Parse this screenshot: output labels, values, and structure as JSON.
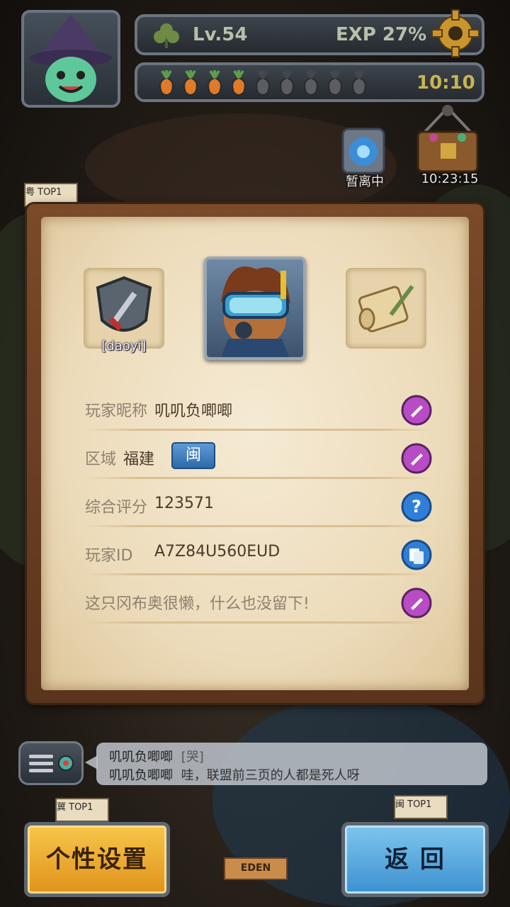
{
  "header": {
    "level": "Lv.54",
    "exp": "EXP 27%",
    "energy_total": 9,
    "energy_filled": 4,
    "timer": "10:10"
  },
  "quick": {
    "portal_label": "暂离中",
    "chest_timer": "10:23:15"
  },
  "profile": {
    "guild_tag": "[daoyi]",
    "rows": [
      {
        "label": "玩家昵称",
        "value": "叽叽负唧唧",
        "action": "edit"
      },
      {
        "label": "区域",
        "value": "福建",
        "badge": "闽",
        "action": "edit"
      },
      {
        "label": "综合评分",
        "value": "123571",
        "action": "help"
      },
      {
        "label": "玩家ID",
        "value": "A7Z84U560EUD",
        "action": "copy"
      },
      {
        "label": "这只冈布奥很懒，什么也没留下!",
        "value": "",
        "action": "edit"
      }
    ]
  },
  "chat": {
    "line1_name": "叽叽负唧唧",
    "line1_msg": "[哭]",
    "line2_name": "叽叽负唧唧",
    "line2_msg": "哇，联盟前三页的人都是死人呀"
  },
  "buttons": {
    "personal": "个性设置",
    "back": "返 回"
  },
  "map_tags": {
    "tag1": "粤 TOP1",
    "tag2": "冀 TOP1",
    "tag3": "闽 TOP1",
    "eden": "EDEN"
  },
  "colors": {
    "edit": "#b84cc4",
    "help": "#2f7fd8",
    "copy": "#2f7fd8",
    "accent_gold": "#e0921c",
    "accent_blue": "#3c8fd0"
  }
}
